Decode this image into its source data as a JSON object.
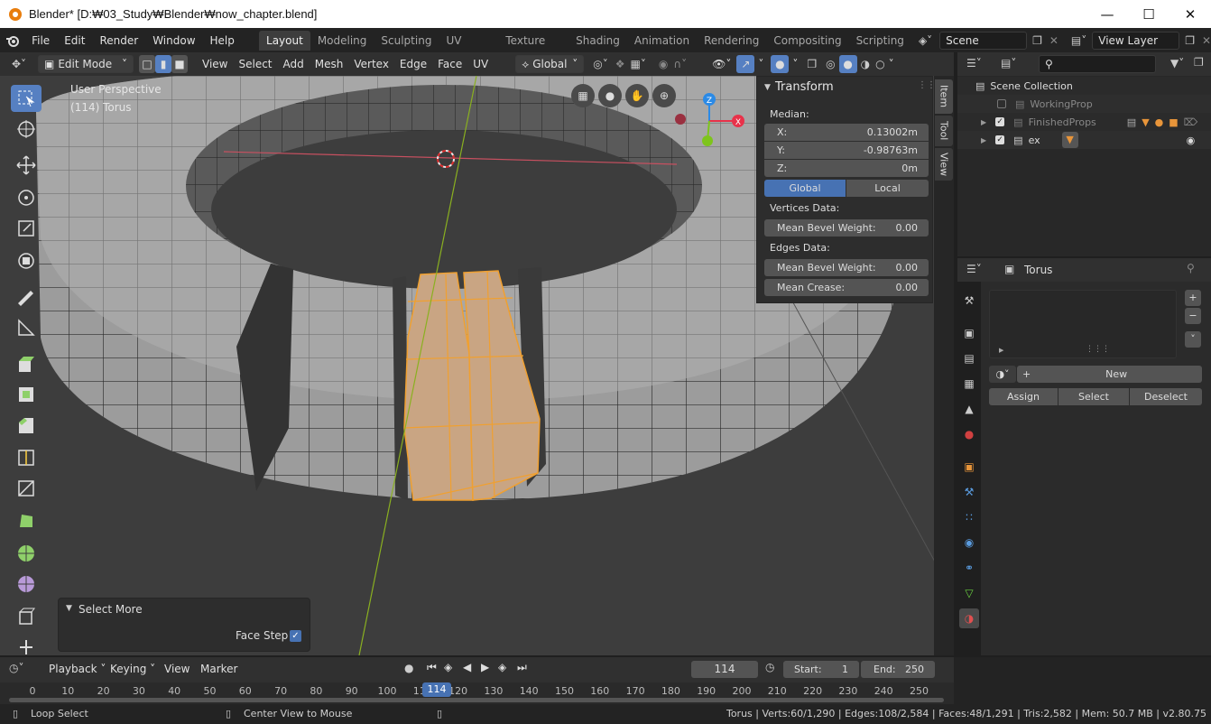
{
  "window": {
    "title": "Blender* [D:₩03_Study₩Blender₩now_chapter.blend]",
    "minimize": "—",
    "maximize": "☐",
    "close": "✕"
  },
  "menubar": {
    "menus": [
      "File",
      "Edit",
      "Render",
      "Window",
      "Help"
    ],
    "workspaces": [
      "Layout",
      "Modeling",
      "Sculpting",
      "UV Editing",
      "Texture Paint",
      "Shading",
      "Animation",
      "Rendering",
      "Compositing",
      "Scripting"
    ],
    "scene": "Scene",
    "view_layer": "View Layer"
  },
  "viewport_header": {
    "mode": "Edit Mode",
    "menus": [
      "View",
      "Select",
      "Add",
      "Mesh",
      "Vertex",
      "Edge",
      "Face",
      "UV"
    ],
    "orientation": "Global"
  },
  "viewport": {
    "perspective": "User Perspective",
    "object": "(114) Torus"
  },
  "gizmo": {
    "x": "X",
    "y": "Y",
    "z": "Z"
  },
  "npanel": {
    "title": "Transform",
    "median_label": "Median:",
    "x_label": "X:",
    "x_value": "0.13002m",
    "y_label": "Y:",
    "y_value": "-0.98763m",
    "z_label": "Z:",
    "z_value": "0m",
    "global": "Global",
    "local": "Local",
    "vertices_label": "Vertices Data:",
    "vert_bevel_label": "Mean Bevel Weight:",
    "vert_bevel_value": "0.00",
    "edges_label": "Edges Data:",
    "edge_bevel_label": "Mean Bevel Weight:",
    "edge_bevel_value": "0.00",
    "crease_label": "Mean Crease:",
    "crease_value": "0.00",
    "tabs": [
      "Item",
      "Tool",
      "View"
    ]
  },
  "redo_panel": {
    "title": "Select More",
    "face_step_label": "Face Step",
    "face_step_checked": true
  },
  "outliner": {
    "root": "Scene Collection",
    "items": [
      {
        "name": "WorkingProp",
        "checked": false
      },
      {
        "name": "FinishedProps",
        "checked": true
      },
      {
        "name": "ex",
        "checked": true
      }
    ]
  },
  "properties": {
    "object_name": "Torus",
    "new_label": "New",
    "assign": "Assign",
    "select": "Select",
    "deselect": "Deselect"
  },
  "timeline": {
    "menus": [
      "Playback",
      "Keying",
      "View",
      "Marker"
    ],
    "current_frame": "114",
    "start_label": "Start:",
    "start": "1",
    "end_label": "End:",
    "end": "250",
    "ticks": [
      "0",
      "10",
      "20",
      "30",
      "40",
      "50",
      "60",
      "70",
      "80",
      "90",
      "100",
      "110",
      "120",
      "130",
      "140",
      "150",
      "160",
      "170",
      "180",
      "190",
      "200",
      "210",
      "220",
      "230",
      "240",
      "250"
    ],
    "playhead_label": "114"
  },
  "statusbar": {
    "loop_select": "Loop Select",
    "center_view": "Center View to Mouse",
    "stats": "Torus | Verts:60/1,290 | Edges:108/2,584 | Faces:48/1,291 | Tris:2,582 | Mem: 50.7 MB | v2.80.75"
  },
  "colors": {
    "accent": "#5680c2",
    "selection": "#f0a030",
    "axis_x": "#e8324a",
    "axis_y": "#7ec41c",
    "axis_z": "#2b8ae6"
  }
}
